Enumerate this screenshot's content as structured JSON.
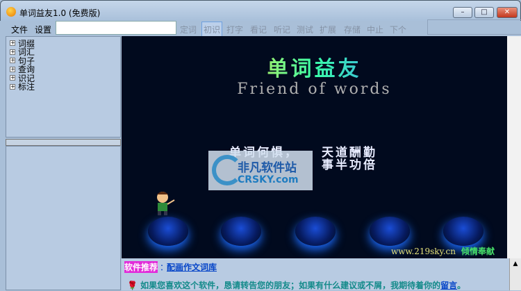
{
  "window": {
    "title": "单词益友1.0 (免费版)",
    "minimize": "–",
    "maximize": "□",
    "close": "✕"
  },
  "menu": {
    "file": "文件",
    "settings": "设置",
    "search_value": ""
  },
  "toolbar": [
    "定词",
    "初识",
    "打字",
    "看记",
    "听记",
    "测试",
    "扩展",
    "存储",
    "中止",
    "下个"
  ],
  "toolbar_active": "初识",
  "tree": [
    "词缀",
    "词汇",
    "句子",
    "查询",
    "识记",
    "标注"
  ],
  "splash": {
    "title": "单词益友",
    "subtitle": "Friend of words",
    "poem_left": "单词何惧，",
    "poem_right_1": "天道酬勤",
    "poem_right_2": "事半功倍",
    "site": "www.219sky.cn",
    "credit": "倾情奉献"
  },
  "watermark": {
    "cn": "非凡软件站",
    "en": "CRSKY.com"
  },
  "bottom": {
    "recommend_label": "软件推荐",
    "recommend_sep": "：",
    "recommend_link": "配画作文词库",
    "message": "如果您喜欢这个软件，恳请转告您的朋友；如果有什么建议或不屑，我期待着你的",
    "message_link": "留言",
    "message_end": "。"
  }
}
